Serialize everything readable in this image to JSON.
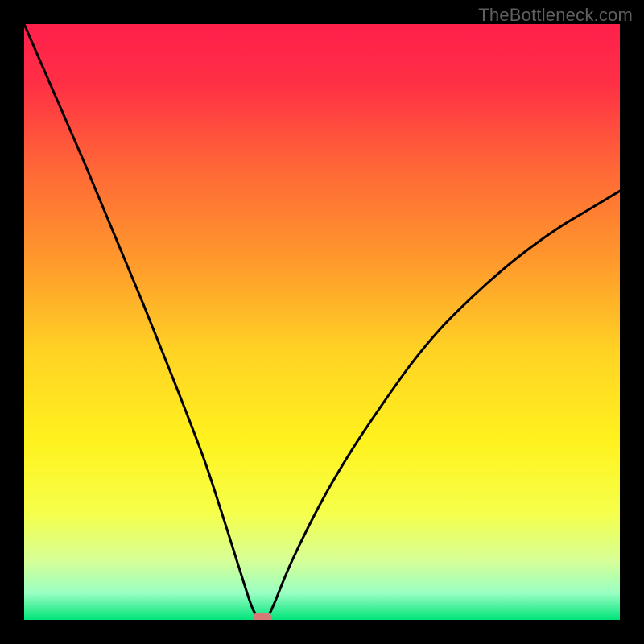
{
  "watermark": "TheBottleneck.com",
  "chart_data": {
    "type": "line",
    "title": "",
    "xlabel": "",
    "ylabel": "",
    "xlim": [
      0,
      100
    ],
    "ylim": [
      0,
      100
    ],
    "grid": false,
    "legend": false,
    "series": [
      {
        "name": "curve",
        "x": [
          0,
          5,
          10,
          15,
          20,
          25,
          30,
          33,
          36,
          38,
          39,
          40,
          41,
          42,
          45,
          50,
          55,
          60,
          65,
          70,
          75,
          80,
          85,
          90,
          95,
          100
        ],
        "values": [
          100,
          88.5,
          77,
          65,
          53,
          40.5,
          27.5,
          18.5,
          9,
          2.8,
          0.8,
          0,
          0.8,
          2.8,
          10,
          20,
          28.5,
          36,
          43,
          49,
          54,
          58.5,
          62.5,
          66,
          69,
          72
        ]
      }
    ],
    "marker": {
      "x": 40,
      "y": 0
    },
    "gradient_stops": [
      {
        "offset": 0,
        "color": "#ff1f4b"
      },
      {
        "offset": 0.1,
        "color": "#ff3045"
      },
      {
        "offset": 0.25,
        "color": "#ff6a36"
      },
      {
        "offset": 0.4,
        "color": "#ff9a2c"
      },
      {
        "offset": 0.55,
        "color": "#ffd324"
      },
      {
        "offset": 0.7,
        "color": "#fff21e"
      },
      {
        "offset": 0.82,
        "color": "#f6ff4a"
      },
      {
        "offset": 0.9,
        "color": "#d7ff96"
      },
      {
        "offset": 0.955,
        "color": "#99ffc2"
      },
      {
        "offset": 1.0,
        "color": "#00e47a"
      }
    ]
  }
}
